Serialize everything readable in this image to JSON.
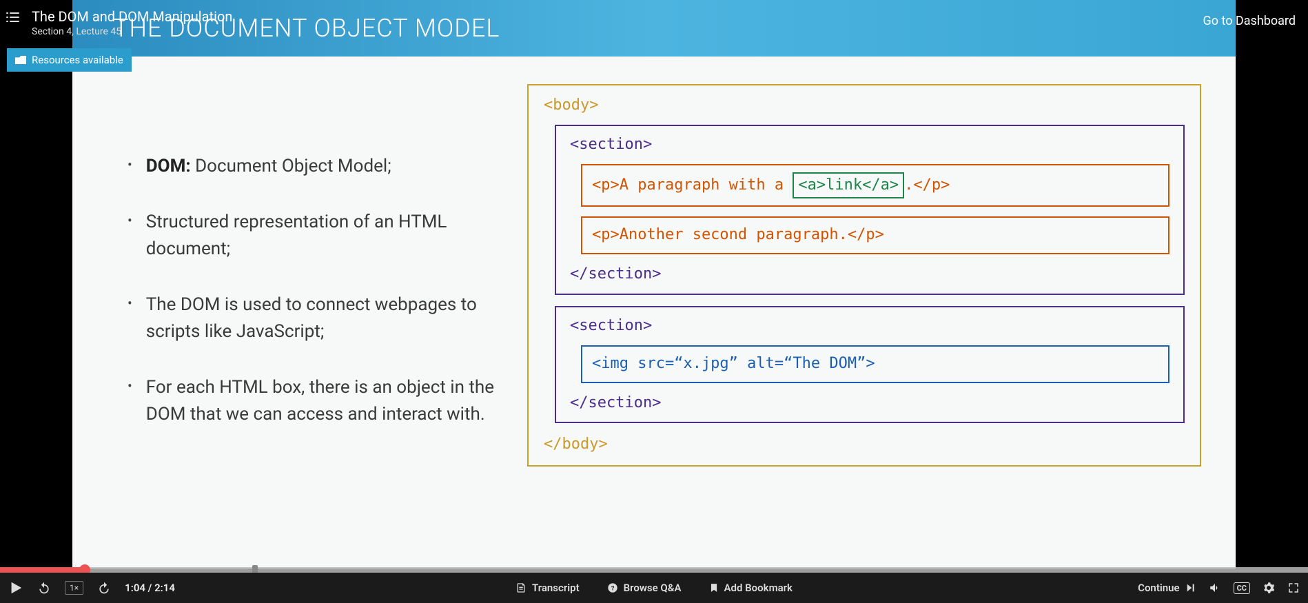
{
  "header": {
    "lecture_title": "The DOM and DOM Manipulation",
    "lecture_subtitle": "Section 4, Lecture 45",
    "dashboard_link": "Go to Dashboard",
    "resources_label": "Resources available"
  },
  "slide": {
    "title": "THE DOCUMENT OBJECT MODEL",
    "bullets": [
      {
        "bold": "DOM:",
        "rest": " Document Object Model;"
      },
      {
        "bold": "",
        "rest": "Structured representation of an HTML document;"
      },
      {
        "bold": "",
        "rest": "The DOM is used to connect webpages to scripts like JavaScript;"
      },
      {
        "bold": "",
        "rest": "For each HTML box, there is an object in the DOM that we can access and interact with."
      }
    ],
    "code": {
      "body_open": "<body>",
      "body_close": "</body>",
      "section_open": "<section>",
      "section_close": "</section>",
      "p1_pre": "<p>A paragraph with a ",
      "a_inner": "<a>link</a>",
      "p1_post": ".</p>",
      "p2": "<p>Another second paragraph.</p>",
      "img_line": "<img src=“x.jpg” alt=“The DOM”>"
    }
  },
  "player": {
    "current_time": "1:04",
    "duration": "2:14",
    "time_display": "1:04 / 2:14",
    "speed": "1×",
    "progress_played_pct": 6.5,
    "progress_buffered_pct": 100,
    "marker_pct": 19.5,
    "transcript_label": "Transcript",
    "qa_label": "Browse Q&A",
    "bookmark_label": "Add Bookmark",
    "continue_label": "Continue",
    "cc_label": "CC"
  }
}
